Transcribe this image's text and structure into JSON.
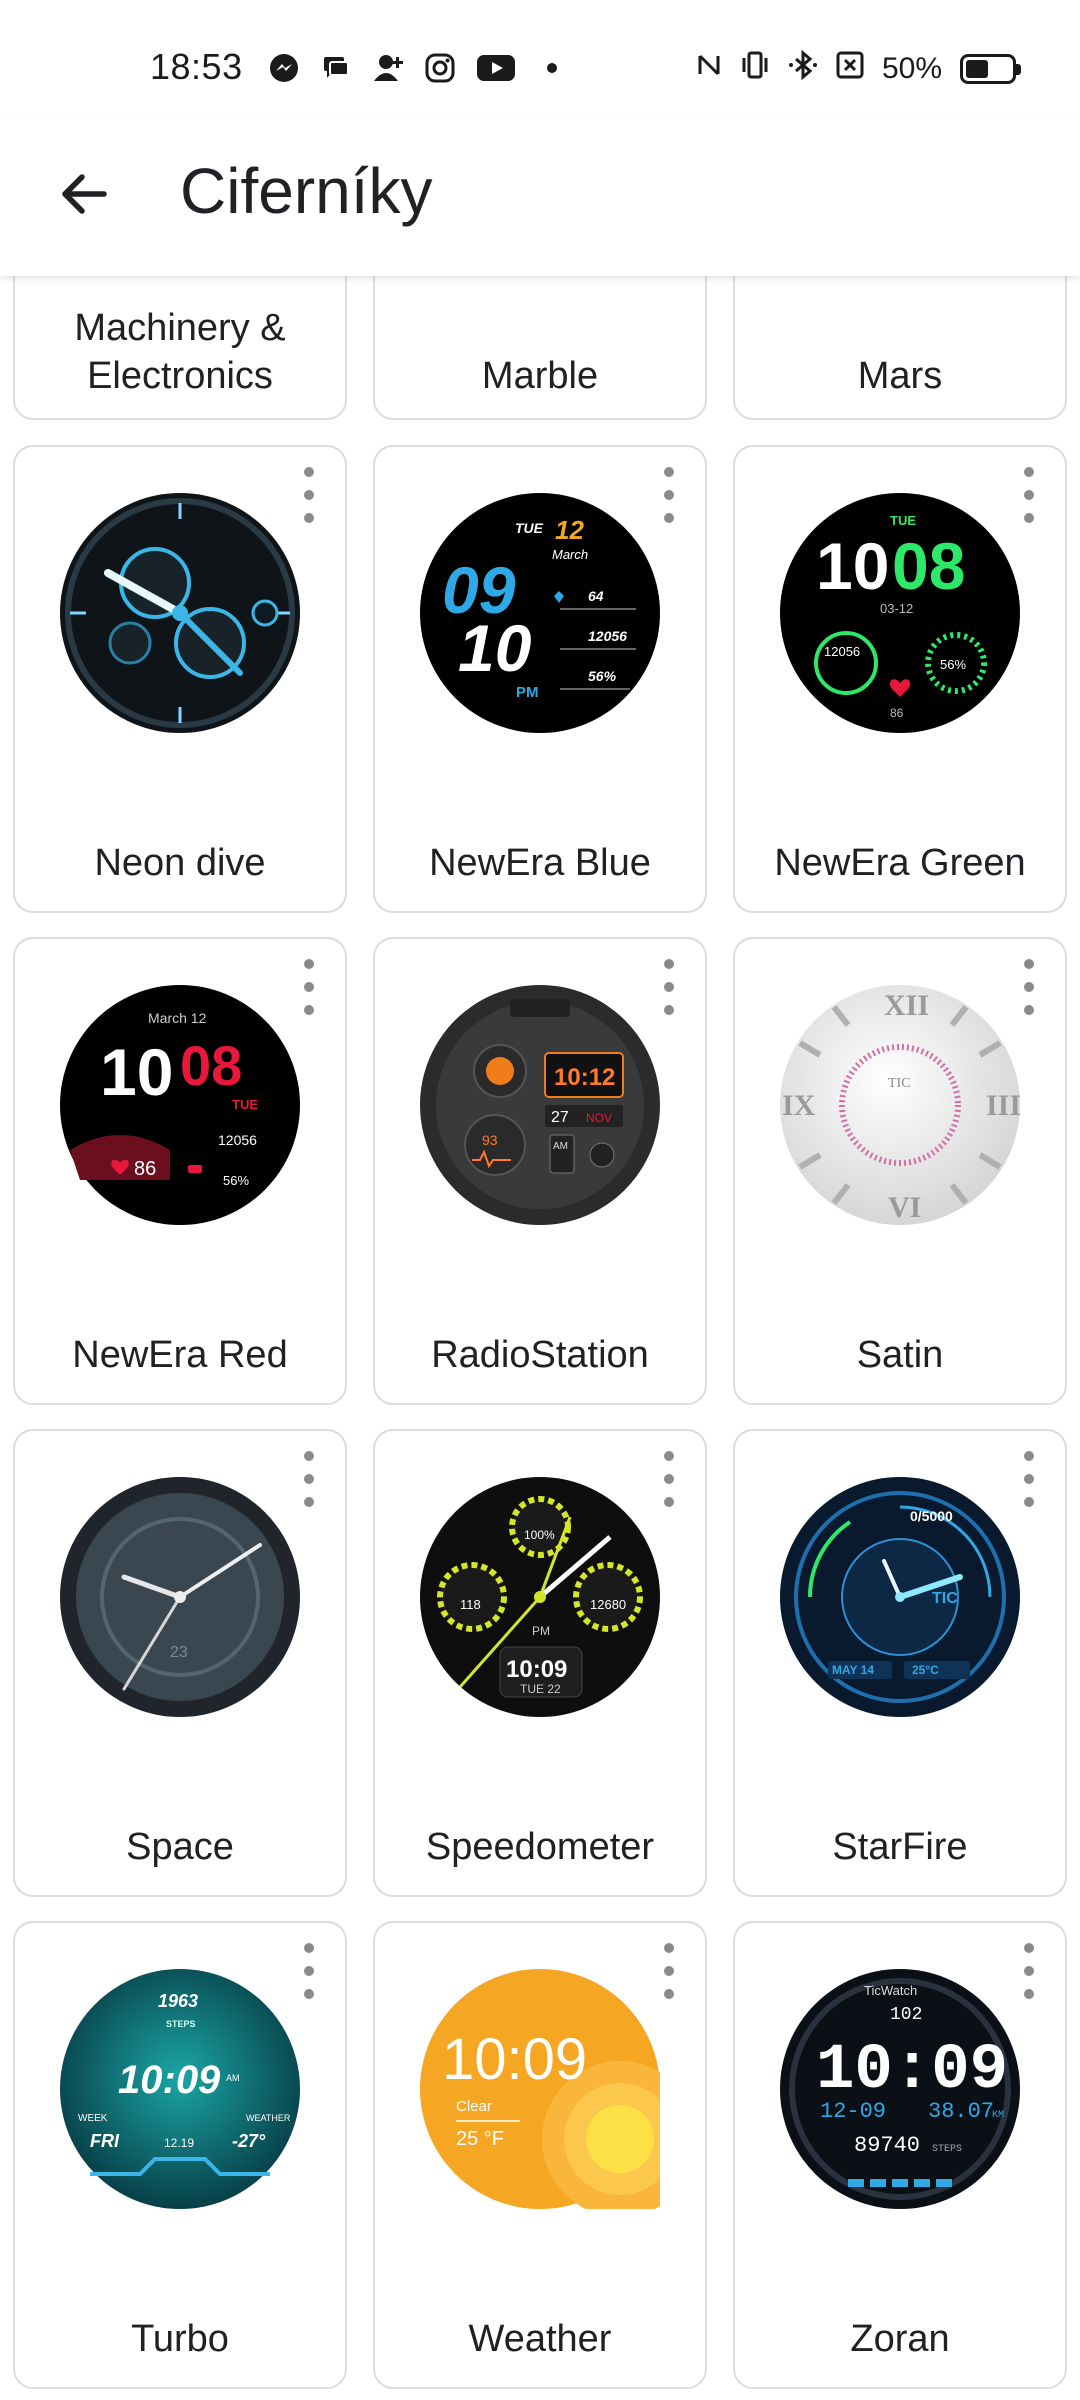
{
  "status_bar": {
    "time": "18:53",
    "battery_text": "50%",
    "notification_icons": [
      "messenger-icon",
      "chat-icon",
      "person-add-icon",
      "instagram-icon",
      "youtube-icon",
      "dot-icon"
    ],
    "system_icons": [
      "nfc-icon",
      "vibrate-icon",
      "bluetooth-icon",
      "no-sim-icon",
      "battery-icon"
    ]
  },
  "app_bar": {
    "title": "Ciferníky",
    "back_icon": "arrow-left-icon"
  },
  "partial_row": [
    "Machinery & Electronics",
    "Marble",
    "Mars"
  ],
  "faces": [
    {
      "name": "Neon dive"
    },
    {
      "name": "NewEra Blue",
      "texts": {
        "day": "TUE",
        "date": "12",
        "month": "March",
        "hour": "09",
        "min": "10",
        "ampm": "PM",
        "hr": "64",
        "steps": "12056",
        "batt": "56%"
      }
    },
    {
      "name": "NewEra Green",
      "texts": {
        "day": "TUE",
        "hour": "10",
        "min": "08",
        "date": "03-12",
        "steps": "12056",
        "batt": "56%",
        "hr": "86"
      }
    },
    {
      "name": "NewEra Red",
      "texts": {
        "date": "March  12",
        "hour": "10",
        "min": "08",
        "day": "TUE",
        "hr": "86",
        "steps": "12056",
        "batt": "56%"
      }
    },
    {
      "name": "RadioStation",
      "texts": {
        "time": "10:12",
        "day": "27",
        "month": "NOV",
        "hr": "93",
        "ampm": "AM"
      }
    },
    {
      "name": "Satin",
      "texts": {
        "brand": "TIC"
      }
    },
    {
      "name": "Space",
      "texts": {
        "date": "23"
      }
    },
    {
      "name": "Speedometer",
      "texts": {
        "batt": "100%",
        "hr": "118",
        "steps": "12680",
        "ampm": "PM",
        "time": "10:09",
        "date": "TUE 22"
      }
    },
    {
      "name": "StarFire",
      "texts": {
        "steps": "0/5000",
        "date": "MAY 14",
        "temp": "25°C",
        "brand": "TIC"
      }
    },
    {
      "name": "Turbo",
      "texts": {
        "steps": "1963",
        "steps_label": "STEPS",
        "time": "10:09",
        "ampm": "AM",
        "day": "FRI",
        "date": "12.19",
        "temp": "-27°",
        "week": "WEEK",
        "weather": "WEATHER"
      }
    },
    {
      "name": "Weather",
      "texts": {
        "time": "10:09",
        "cond": "Clear",
        "temp": "25 °F"
      }
    },
    {
      "name": "Zoran",
      "texts": {
        "brand": "TicWatch",
        "hr": "102",
        "time": "10:09",
        "date": "12-09",
        "dist": "38.07",
        "unit": "KM",
        "steps": "89740",
        "steps_label": "STEPS"
      }
    }
  ],
  "colors": {
    "accent_blue": "#2fa9e6",
    "accent_orange": "#f5a623",
    "accent_green": "#2ee86a",
    "accent_red": "#e8173c",
    "card_border": "#dadce0"
  }
}
